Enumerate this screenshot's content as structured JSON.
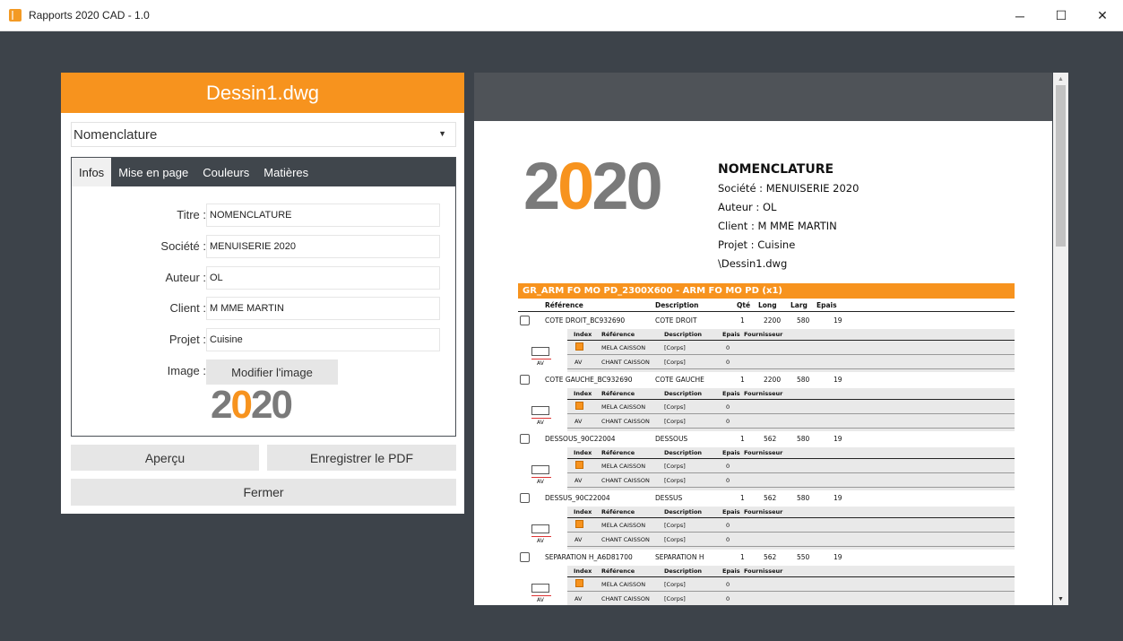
{
  "window": {
    "title": "Rapports 2020 CAD - 1.0",
    "minimize": "─",
    "maximize": "☐",
    "close": "✕"
  },
  "colors": {
    "accent": "#f7931e",
    "dark": "#40464c",
    "background": "#3d434a"
  },
  "left": {
    "file_name": "Dessin1.dwg",
    "report_type": "Nomenclature",
    "select_arrow": "▼",
    "tabs": [
      {
        "label": "Infos"
      },
      {
        "label": "Mise en page"
      },
      {
        "label": "Couleurs"
      },
      {
        "label": "Matières"
      }
    ],
    "form": {
      "titre_label": "Titre :",
      "titre_value": "NOMENCLATURE",
      "societe_label": "Société :",
      "societe_value": "MENUISERIE 2020",
      "auteur_label": "Auteur :",
      "auteur_value": "OL",
      "client_label": "Client :",
      "client_value": "M MME MARTIN",
      "projet_label": "Projet :",
      "projet_value": "Cuisine",
      "image_label": "Image :",
      "image_button": "Modifier l'image"
    },
    "logo_text": "2020",
    "buttons": {
      "preview": "Aperçu",
      "save_pdf": "Enregistrer le PDF",
      "close": "Fermer"
    }
  },
  "preview": {
    "logo_text": "2020",
    "title": "NOMENCLATURE",
    "societe": "Société : MENUISERIE 2020",
    "auteur": "Auteur : OL",
    "client": "Client : M MME MARTIN",
    "projet": "Projet : Cuisine",
    "file": "\\Dessin1.dwg",
    "group_title": "GR_ARM FO MO PD_2300X600 - ARM FO MO PD (x1)",
    "headers": {
      "ref": "Référence",
      "desc": "Description",
      "qte": "Qté",
      "long": "Long",
      "larg": "Larg",
      "epais": "Epais"
    },
    "sub_headers": {
      "index": "Index",
      "ref": "Référence",
      "desc": "Description",
      "epais": "Epais",
      "fournisseur": "Fournisseur"
    },
    "parts": [
      {
        "ref": "COTE DROIT_BC932690",
        "desc": "COTE DROIT",
        "qte": "1",
        "long": "2200",
        "larg": "580",
        "epais": "19",
        "mat": {
          "ref": "MELA CAISSON",
          "desc": "[Corps]",
          "epais": "0"
        },
        "edge": {
          "index": "AV",
          "ref": "CHANT CAISSON",
          "desc": "[Corps]",
          "epais": "0"
        },
        "icon_label": "AV"
      },
      {
        "ref": "COTE GAUCHE_BC932690",
        "desc": "COTE GAUCHE",
        "qte": "1",
        "long": "2200",
        "larg": "580",
        "epais": "19",
        "mat": {
          "ref": "MELA CAISSON",
          "desc": "[Corps]",
          "epais": "0"
        },
        "edge": {
          "index": "AV",
          "ref": "CHANT CAISSON",
          "desc": "[Corps]",
          "epais": "0"
        },
        "icon_label": "AV"
      },
      {
        "ref": "DESSOUS_90C22004",
        "desc": "DESSOUS",
        "qte": "1",
        "long": "562",
        "larg": "580",
        "epais": "19",
        "mat": {
          "ref": "MELA CAISSON",
          "desc": "[Corps]",
          "epais": "0"
        },
        "edge": {
          "index": "AV",
          "ref": "CHANT CAISSON",
          "desc": "[Corps]",
          "epais": "0"
        },
        "icon_label": "AV"
      },
      {
        "ref": "DESSUS_90C22004",
        "desc": "DESSUS",
        "qte": "1",
        "long": "562",
        "larg": "580",
        "epais": "19",
        "mat": {
          "ref": "MELA CAISSON",
          "desc": "[Corps]",
          "epais": "0"
        },
        "edge": {
          "index": "AV",
          "ref": "CHANT CAISSON",
          "desc": "[Corps]",
          "epais": "0"
        },
        "icon_label": "AV"
      },
      {
        "ref": "SEPARATION H_A6D81700",
        "desc": "SEPARATION H",
        "qte": "1",
        "long": "562",
        "larg": "550",
        "epais": "19",
        "mat": {
          "ref": "MELA CAISSON",
          "desc": "[Corps]",
          "epais": "0"
        },
        "edge": {
          "index": "AV",
          "ref": "CHANT CAISSON",
          "desc": "[Corps]",
          "epais": "0"
        },
        "icon_label": "AV"
      }
    ]
  },
  "scrollbar": {
    "up": "▲",
    "down": "▼"
  }
}
